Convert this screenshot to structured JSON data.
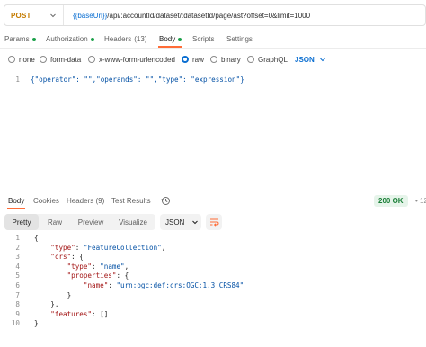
{
  "request": {
    "method": "POST",
    "url_variable": "{{baseUrl}}",
    "url_path": " /api/:accountId/dataset/:datasetId/page/ast?offset=0&limit=1000"
  },
  "request_tabs": [
    {
      "label": "Params",
      "dot": true
    },
    {
      "label": "Authorization",
      "dot": true
    },
    {
      "label": "Headers",
      "count": "(13)"
    },
    {
      "label": "Body",
      "dot": true,
      "active": true
    },
    {
      "label": "Scripts"
    },
    {
      "label": "Settings"
    }
  ],
  "body_types": [
    {
      "label": "none",
      "selected": false
    },
    {
      "label": "form-data",
      "selected": false
    },
    {
      "label": "x-www-form-urlencoded",
      "selected": false
    },
    {
      "label": "raw",
      "selected": true
    },
    {
      "label": "binary",
      "selected": false
    },
    {
      "label": "GraphQL",
      "selected": false
    }
  ],
  "raw_format": "JSON",
  "request_body": {
    "line_number": "1",
    "text": "{\"operator\": \"\",\"operands\": \"\",\"type\": \"expression\"}"
  },
  "response_tabs": [
    {
      "label": "Body",
      "active": true
    },
    {
      "label": "Cookies"
    },
    {
      "label": "Headers",
      "count": "(9)"
    },
    {
      "label": "Test Results"
    }
  ],
  "response_status": "200 OK",
  "response_status_more": "• 12",
  "view_modes": [
    {
      "label": "Pretty",
      "active": true
    },
    {
      "label": "Raw"
    },
    {
      "label": "Preview"
    },
    {
      "label": "Visualize"
    }
  ],
  "response_format": "JSON",
  "icons": {
    "method_dropdown": "chevron-down-icon",
    "raw_format_dropdown": "chevron-down-icon",
    "history": "history-icon",
    "response_format_dropdown": "chevron-down-icon",
    "wrap": "wrap-lines-icon"
  },
  "colors": {
    "method": "#c47b00",
    "variable": "#0a6ed1",
    "accent": "#ff6c37",
    "status_ok": "#1a7f37",
    "dot": "#1ba049"
  },
  "response_body": [
    {
      "n": "1",
      "tokens": [
        {
          "t": "{",
          "c": "p"
        }
      ]
    },
    {
      "n": "2",
      "tokens": [
        {
          "t": "    ",
          "c": "p"
        },
        {
          "t": "\"type\"",
          "c": "key"
        },
        {
          "t": ": ",
          "c": "p"
        },
        {
          "t": "\"FeatureCollection\"",
          "c": "s"
        },
        {
          "t": ",",
          "c": "p"
        }
      ]
    },
    {
      "n": "3",
      "tokens": [
        {
          "t": "    ",
          "c": "p"
        },
        {
          "t": "\"crs\"",
          "c": "key"
        },
        {
          "t": ": {",
          "c": "p"
        }
      ]
    },
    {
      "n": "4",
      "tokens": [
        {
          "t": "        ",
          "c": "p"
        },
        {
          "t": "\"type\"",
          "c": "key"
        },
        {
          "t": ": ",
          "c": "p"
        },
        {
          "t": "\"name\"",
          "c": "s"
        },
        {
          "t": ",",
          "c": "p"
        }
      ]
    },
    {
      "n": "5",
      "tokens": [
        {
          "t": "        ",
          "c": "p"
        },
        {
          "t": "\"properties\"",
          "c": "key"
        },
        {
          "t": ": {",
          "c": "p"
        }
      ]
    },
    {
      "n": "6",
      "tokens": [
        {
          "t": "            ",
          "c": "p"
        },
        {
          "t": "\"name\"",
          "c": "key"
        },
        {
          "t": ": ",
          "c": "p"
        },
        {
          "t": "\"urn:ogc:def:crs:OGC:1.3:CRS84\"",
          "c": "s"
        }
      ]
    },
    {
      "n": "7",
      "tokens": [
        {
          "t": "        }",
          "c": "p"
        }
      ]
    },
    {
      "n": "8",
      "tokens": [
        {
          "t": "    },",
          "c": "p"
        }
      ]
    },
    {
      "n": "9",
      "tokens": [
        {
          "t": "    ",
          "c": "p"
        },
        {
          "t": "\"features\"",
          "c": "key"
        },
        {
          "t": ": []",
          "c": "p"
        }
      ]
    },
    {
      "n": "10",
      "tokens": [
        {
          "t": "}",
          "c": "p"
        }
      ]
    }
  ]
}
